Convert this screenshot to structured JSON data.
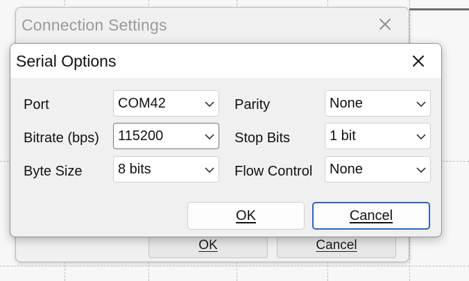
{
  "back_dialog": {
    "title": "Connection Settings",
    "close_icon": "close-icon",
    "ok_label": "OK",
    "cancel_label": "Cancel"
  },
  "dialog": {
    "title": "Serial Options",
    "close_icon": "close-icon",
    "fields": {
      "port": {
        "label": "Port",
        "value": "COM42"
      },
      "bitrate": {
        "label": "Bitrate (bps)",
        "value": "115200"
      },
      "byte_size": {
        "label": "Byte Size",
        "value": "8 bits"
      },
      "parity": {
        "label": "Parity",
        "value": "None"
      },
      "stop_bits": {
        "label": "Stop Bits",
        "value": "1 bit"
      },
      "flow_control": {
        "label": "Flow Control",
        "value": "None"
      }
    },
    "buttons": {
      "ok_label": "OK",
      "cancel_label": "Cancel"
    }
  },
  "colors": {
    "default_button_border": "#2b63c8",
    "background": "#f0f0f0"
  }
}
